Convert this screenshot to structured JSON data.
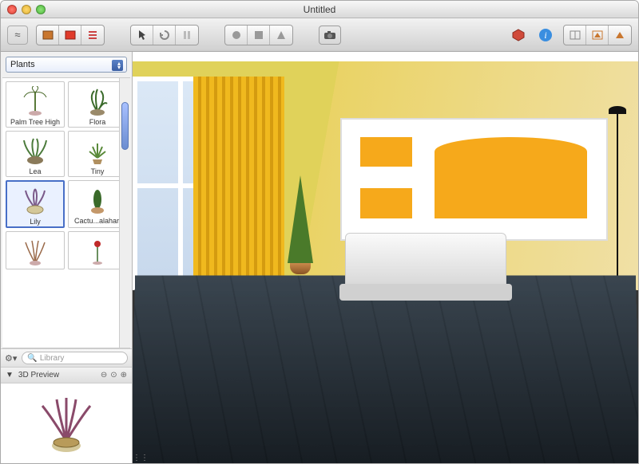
{
  "window": {
    "title": "Untitled"
  },
  "toolbar": {
    "left_icons": [
      "link-icon",
      "library-icon",
      "color-icon",
      "list-icon"
    ],
    "tool_icons": [
      "pointer-icon",
      "rotate-icon",
      "pan-icon"
    ],
    "shape_icons": [
      "circle-icon",
      "square-icon",
      "triangle-icon"
    ],
    "camera_icon": "camera-icon",
    "right_icons": [
      "package-icon",
      "info-icon",
      "layout-2d-icon",
      "layout-split-icon",
      "layout-3d-icon"
    ]
  },
  "library": {
    "category_selected": "Plants",
    "items": [
      {
        "name": "Palm Tree High"
      },
      {
        "name": "Flora"
      },
      {
        "name": "Lea"
      },
      {
        "name": "Tiny"
      },
      {
        "name": "Lily",
        "selected": true
      },
      {
        "name": "Cactu...alahari"
      },
      {
        "name": ""
      },
      {
        "name": ""
      }
    ],
    "search_placeholder": "Library"
  },
  "preview": {
    "header": "3D Preview",
    "item_name": "Lily"
  }
}
